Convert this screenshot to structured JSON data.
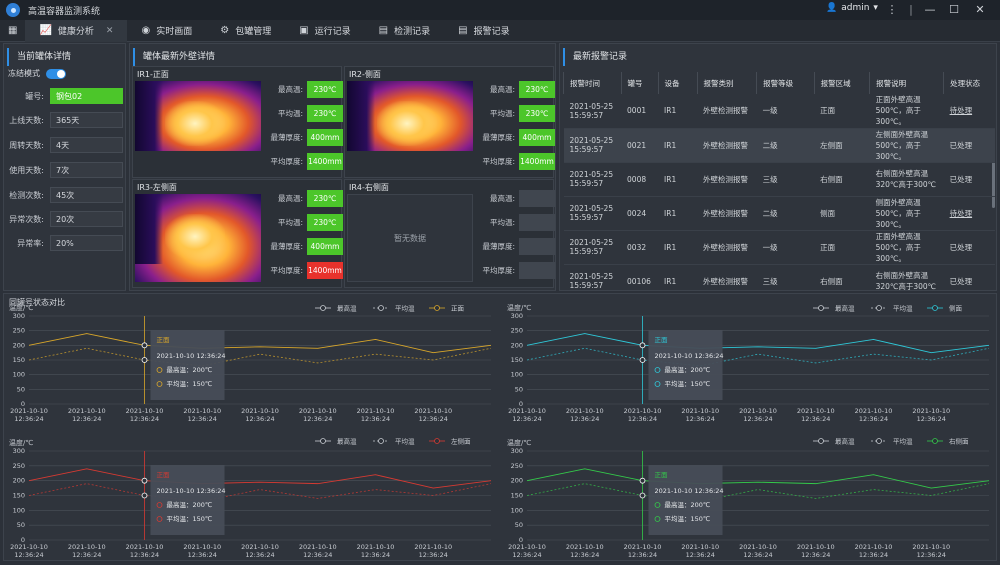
{
  "app": {
    "title": "高温容器监测系统",
    "user": "admin"
  },
  "tabs": [
    {
      "label": "健康分析",
      "active": true
    },
    {
      "label": "实时画面"
    },
    {
      "label": "包罐管理"
    },
    {
      "label": "运行记录"
    },
    {
      "label": "检测记录"
    },
    {
      "label": "报警记录"
    }
  ],
  "current": {
    "title": "当前罐体详情",
    "freeze_label": "冻结模式",
    "fields": [
      {
        "label": "罐号:",
        "value": "钢包02"
      },
      {
        "label": "上线天数:",
        "value": "365天"
      },
      {
        "label": "周转天数:",
        "value": "4天"
      },
      {
        "label": "使用天数:",
        "value": "7次"
      },
      {
        "label": "检测次数:",
        "value": "45次"
      },
      {
        "label": "异常次数:",
        "value": "20次"
      },
      {
        "label": "异常率:",
        "value": "20%"
      }
    ]
  },
  "walls": {
    "title": "罐体最新外壁详情",
    "metric_labels": [
      "最高温:",
      "平均温:",
      "最薄厚度:",
      "平均厚度:"
    ],
    "no_data": "暂无数据",
    "boxes": [
      {
        "name": "IR1-正面",
        "values": [
          "230℃",
          "230℃",
          "400mm",
          "1400mm"
        ]
      },
      {
        "name": "IR2-侧面",
        "values": [
          "230℃",
          "230℃",
          "400mm",
          "1400mm"
        ]
      },
      {
        "name": "IR3-左侧面",
        "values": [
          "230℃",
          "230℃",
          "400mm",
          "1400mm"
        ]
      },
      {
        "name": "IR4-右侧面",
        "values": [
          "",
          "",
          "",
          ""
        ]
      }
    ]
  },
  "alarms": {
    "title": "最新报警记录",
    "headers": [
      "报警时间",
      "罐号",
      "设备",
      "报警类别",
      "报警等级",
      "报警区域",
      "报警说明",
      "处理状态"
    ],
    "rows": [
      {
        "time": "2021-05-25 15:59:57",
        "tank": "0001",
        "device": "IR1",
        "category": "外壁检测报警",
        "level": "一级",
        "area": "正面",
        "desc": "正面外壁高温500℃，高于300℃。",
        "status": "待处理"
      },
      {
        "time": "2021-05-25 15:59:57",
        "tank": "0021",
        "device": "IR1",
        "category": "外壁检测报警",
        "level": "二级",
        "area": "左侧面",
        "desc": "左侧面外壁高温500℃，高于300℃。",
        "status": "已处理"
      },
      {
        "time": "2021-05-25 15:59:57",
        "tank": "0008",
        "device": "IR1",
        "category": "外壁检测报警",
        "level": "三级",
        "area": "右侧面",
        "desc": "右侧面外壁高温320℃高于300℃",
        "status": "已处理"
      },
      {
        "time": "2021-05-25 15:59:57",
        "tank": "0024",
        "device": "IR1",
        "category": "外壁检测报警",
        "level": "二级",
        "area": "侧面",
        "desc": "侧面外壁高温500℃，高于300℃。",
        "status": "待处理"
      },
      {
        "time": "2021-05-25 15:59:57",
        "tank": "0032",
        "device": "IR1",
        "category": "外壁检测报警",
        "level": "一级",
        "area": "正面",
        "desc": "正面外壁高温500℃，高于300℃。",
        "status": "已处理"
      },
      {
        "time": "2021-05-25 15:59:57",
        "tank": "00106",
        "device": "IR1",
        "category": "外壁检测报警",
        "level": "三级",
        "area": "右侧面",
        "desc": "右侧面外壁高温320℃高于300℃",
        "status": "已处理"
      }
    ]
  },
  "compare_title": "同罐号状态对比",
  "chart_data": [
    {
      "type": "line",
      "ylabel": "温度/℃",
      "ylim": [
        0,
        300
      ],
      "yticks": [
        0,
        50,
        100,
        150,
        200,
        250,
        300
      ],
      "color": "#d9a72a",
      "x": [
        "2021-10-10 12:36:24",
        "2021-10-10 12:36:24",
        "2021-10-10 12:36:24",
        "2021-10-10 12:36:24",
        "2021-10-10 12:36:24",
        "2021-10-10 12:36:24",
        "2021-10-10 12:36:24",
        "2021-10-10 12:36:24"
      ],
      "series": [
        {
          "name": "最高温",
          "values": [
            200,
            240,
            200,
            190,
            195,
            190,
            220,
            175,
            200
          ]
        },
        {
          "name": "平均温",
          "values": [
            150,
            190,
            150,
            130,
            170,
            140,
            170,
            150,
            190
          ]
        },
        {
          "name": "正面",
          "values": [
            200,
            240,
            200,
            190,
            195,
            190,
            220,
            175,
            200
          ]
        }
      ],
      "tooltip": {
        "title": "正面",
        "time": "2021-10-10  12:36:24",
        "lines": [
          "最高温：200℃",
          "平均温：150℃"
        ]
      }
    },
    {
      "type": "line",
      "ylabel": "温度/℃",
      "ylim": [
        0,
        300
      ],
      "yticks": [
        0,
        50,
        100,
        150,
        200,
        250,
        300
      ],
      "color": "#2fc8d8",
      "x": [
        "2021-10-10 12:36:24",
        "2021-10-10 12:36:24",
        "2021-10-10 12:36:24",
        "2021-10-10 12:36:24",
        "2021-10-10 12:36:24",
        "2021-10-10 12:36:24",
        "2021-10-10 12:36:24",
        "2021-10-10 12:36:24"
      ],
      "series": [
        {
          "name": "最高温",
          "values": [
            200,
            240,
            200,
            190,
            195,
            190,
            220,
            175,
            200
          ]
        },
        {
          "name": "平均温",
          "values": [
            150,
            190,
            150,
            130,
            170,
            140,
            170,
            150,
            190
          ]
        },
        {
          "name": "侧面",
          "values": [
            200,
            240,
            200,
            190,
            195,
            190,
            220,
            175,
            200
          ]
        }
      ],
      "tooltip": {
        "title": "正面",
        "time": "2021-10-10  12:36:24",
        "lines": [
          "最高温：200℃",
          "平均温：150℃"
        ]
      }
    },
    {
      "type": "line",
      "ylabel": "温度/℃",
      "ylim": [
        0,
        300
      ],
      "yticks": [
        0,
        50,
        100,
        150,
        200,
        250,
        300
      ],
      "color": "#d63a32",
      "x": [
        "2021-10-10 12:36:24",
        "2021-10-10 12:36:24",
        "2021-10-10 12:36:24",
        "2021-10-10 12:36:24",
        "2021-10-10 12:36:24",
        "2021-10-10 12:36:24",
        "2021-10-10 12:36:24",
        "2021-10-10 12:36:24"
      ],
      "series": [
        {
          "name": "最高温",
          "values": [
            200,
            240,
            200,
            190,
            195,
            190,
            220,
            175,
            200
          ]
        },
        {
          "name": "平均温",
          "values": [
            150,
            190,
            150,
            130,
            170,
            140,
            170,
            150,
            190
          ]
        },
        {
          "name": "左侧面",
          "values": [
            200,
            240,
            200,
            190,
            195,
            190,
            220,
            175,
            200
          ]
        }
      ],
      "tooltip": {
        "title": "正面",
        "time": "2021-10-10  12:36:24",
        "lines": [
          "最高温：200℃",
          "平均温：150℃"
        ]
      }
    },
    {
      "type": "line",
      "ylabel": "温度/℃",
      "ylim": [
        0,
        300
      ],
      "yticks": [
        0,
        50,
        100,
        150,
        200,
        250,
        300
      ],
      "color": "#34c94a",
      "x": [
        "2021-10-10 12:36:24",
        "2021-10-10 12:36:24",
        "2021-10-10 12:36:24",
        "2021-10-10 12:36:24",
        "2021-10-10 12:36:24",
        "2021-10-10 12:36:24",
        "2021-10-10 12:36:24",
        "2021-10-10 12:36:24"
      ],
      "series": [
        {
          "name": "最高温",
          "values": [
            200,
            240,
            200,
            190,
            195,
            190,
            220,
            175,
            200
          ]
        },
        {
          "name": "平均温",
          "values": [
            150,
            190,
            150,
            130,
            170,
            140,
            170,
            150,
            190
          ]
        },
        {
          "name": "右侧面",
          "values": [
            200,
            240,
            200,
            190,
            195,
            190,
            220,
            175,
            200
          ]
        }
      ],
      "tooltip": {
        "title": "正面",
        "time": "2021-10-10  12:36:24",
        "lines": [
          "最高温：200℃",
          "平均温：150℃"
        ]
      }
    }
  ]
}
